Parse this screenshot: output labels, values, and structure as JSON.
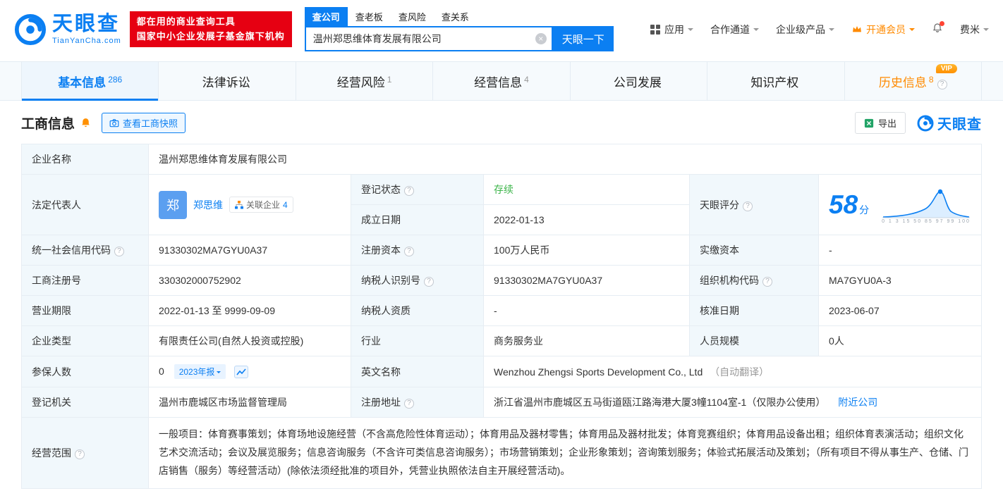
{
  "colors": {
    "primary": "#0b7ff2",
    "vip_orange": "#ff8a00",
    "status_green": "#3cb54a",
    "promo_red": "#e60012"
  },
  "header": {
    "logo": {
      "name": "天眼查",
      "domain": "TianYanCha.com"
    },
    "promo": {
      "line1": "都在用的商业查询工具",
      "line2": "国家中小企业发展子基金旗下机构"
    },
    "search": {
      "tabs": [
        {
          "label": "查公司"
        },
        {
          "label": "查老板"
        },
        {
          "label": "查风险"
        },
        {
          "label": "查关系"
        }
      ],
      "value": "温州郑思维体育发展有限公司",
      "button": "天眼一下"
    },
    "nav": {
      "apps": "应用",
      "cooperation": "合作通道",
      "enterprise": "企业级产品",
      "vip": "开通会员",
      "user": "费米"
    }
  },
  "tabs": [
    {
      "label": "基本信息",
      "count": "286"
    },
    {
      "label": "法律诉讼",
      "count": ""
    },
    {
      "label": "经营风险",
      "count": "1"
    },
    {
      "label": "经营信息",
      "count": "4"
    },
    {
      "label": "公司发展",
      "count": ""
    },
    {
      "label": "知识产权",
      "count": ""
    },
    {
      "label": "历史信息",
      "count": "8",
      "vip_badge": "VIP"
    }
  ],
  "section": {
    "title": "工商信息",
    "snapshot_button": "查看工商快照",
    "export_button": "导出",
    "brand": "天眼查"
  },
  "info": {
    "company_name": {
      "label": "企业名称",
      "value": "温州郑思维体育发展有限公司"
    },
    "legal_rep": {
      "label": "法定代表人",
      "avatar": "郑",
      "name": "郑思维",
      "related_label": "关联企业",
      "related_count": "4"
    },
    "reg_status": {
      "label": "登记状态",
      "value": "存续"
    },
    "establish_date": {
      "label": "成立日期",
      "value": "2022-01-13"
    },
    "score": {
      "label": "天眼评分",
      "value": "58",
      "unit": "分",
      "axis_labels": "0 1 3 15 50 85 97 99 100"
    },
    "credit_code": {
      "label": "统一社会信用代码",
      "value": "91330302MA7GYU0A37"
    },
    "reg_capital": {
      "label": "注册资本",
      "value": "100万人民币"
    },
    "paid_capital": {
      "label": "实缴资本",
      "value": "-"
    },
    "reg_number": {
      "label": "工商注册号",
      "value": "330302000752902"
    },
    "taxpayer_id": {
      "label": "纳税人识别号",
      "value": "91330302MA7GYU0A37"
    },
    "org_code": {
      "label": "组织机构代码",
      "value": "MA7GYU0A-3"
    },
    "business_term": {
      "label": "营业期限",
      "value": "2022-01-13 至 9999-09-09"
    },
    "taxpayer_quality": {
      "label": "纳税人资质",
      "value": "-"
    },
    "approval_date": {
      "label": "核准日期",
      "value": "2023-06-07"
    },
    "company_type": {
      "label": "企业类型",
      "value": "有限责任公司(自然人投资或控股)"
    },
    "industry": {
      "label": "行业",
      "value": "商务服务业"
    },
    "staff_size": {
      "label": "人员规模",
      "value": "0人"
    },
    "insured_count": {
      "label": "参保人数",
      "value": "0",
      "report_badge": "2023年报"
    },
    "english_name": {
      "label": "英文名称",
      "value": "Wenzhou Zhengsi Sports Development Co., Ltd",
      "note": "（自动翻译）"
    },
    "reg_authority": {
      "label": "登记机关",
      "value": "温州市鹿城区市场监督管理局"
    },
    "reg_address": {
      "label": "注册地址",
      "value": "浙江省温州市鹿城区五马街道瓯江路海港大厦3幢1104室-1（仅限办公使用）",
      "link": "附近公司"
    },
    "business_scope": {
      "label": "经营范围",
      "value": "一般项目：体育赛事策划；体育场地设施经营（不含高危险性体育运动）；体育用品及器材零售；体育用品及器材批发；体育竞赛组织；体育用品设备出租；组织体育表演活动；组织文化艺术交流活动；会议及展览服务；信息咨询服务（不含许可类信息咨询服务）；市场营销策划；企业形象策划；咨询策划服务；体验式拓展活动及策划；（所有项目不得从事生产、仓储、门店销售（服务）等经营活动）(除依法须经批准的项目外，凭营业执照依法自主开展经营活动)。"
    }
  }
}
